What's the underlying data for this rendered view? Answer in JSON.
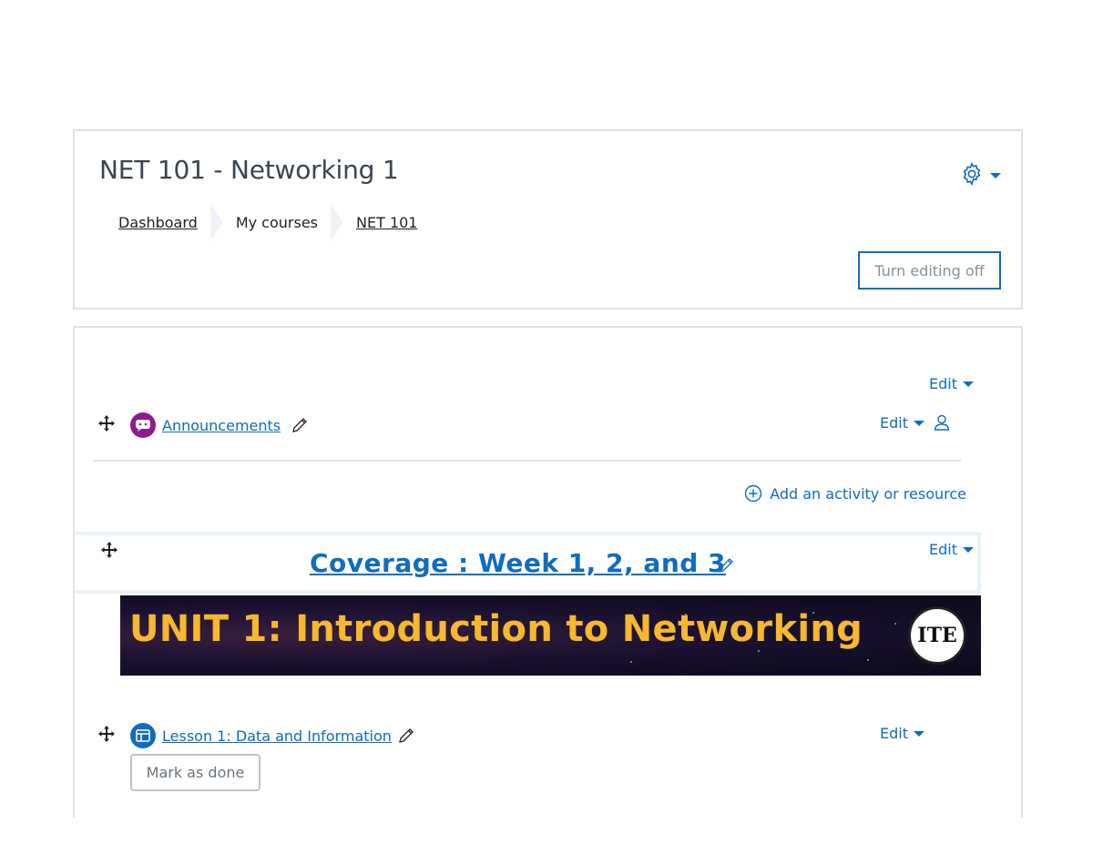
{
  "header": {
    "course_title": "NET 101 - Networking 1",
    "breadcrumb": [
      "Dashboard",
      "My courses",
      "NET 101"
    ],
    "edit_toggle_label": "Turn editing off",
    "settings_icon": "gear-icon"
  },
  "section0": {
    "edit_label": "Edit",
    "announcements": {
      "label": "Announcements",
      "edit_label": "Edit",
      "icon": "forum-icon",
      "icon_color": "#8f1a8f"
    },
    "add_activity_label": "Add an activity or resource"
  },
  "section1": {
    "title": "Coverage : Week 1, 2, and 3",
    "edit_label": "Edit",
    "banner_text": "UNIT 1: Introduction to Networking",
    "banner_logo_text": "ITE",
    "lesson": {
      "label": "Lesson 1: Data and Information",
      "edit_label": "Edit",
      "icon": "page-icon",
      "icon_color": "#0f6cbf"
    },
    "mark_done_label": "Mark as done"
  },
  "colors": {
    "accent": "#0f6cbf",
    "banner_text": "#f5b82e",
    "border": "#dee2e6"
  }
}
